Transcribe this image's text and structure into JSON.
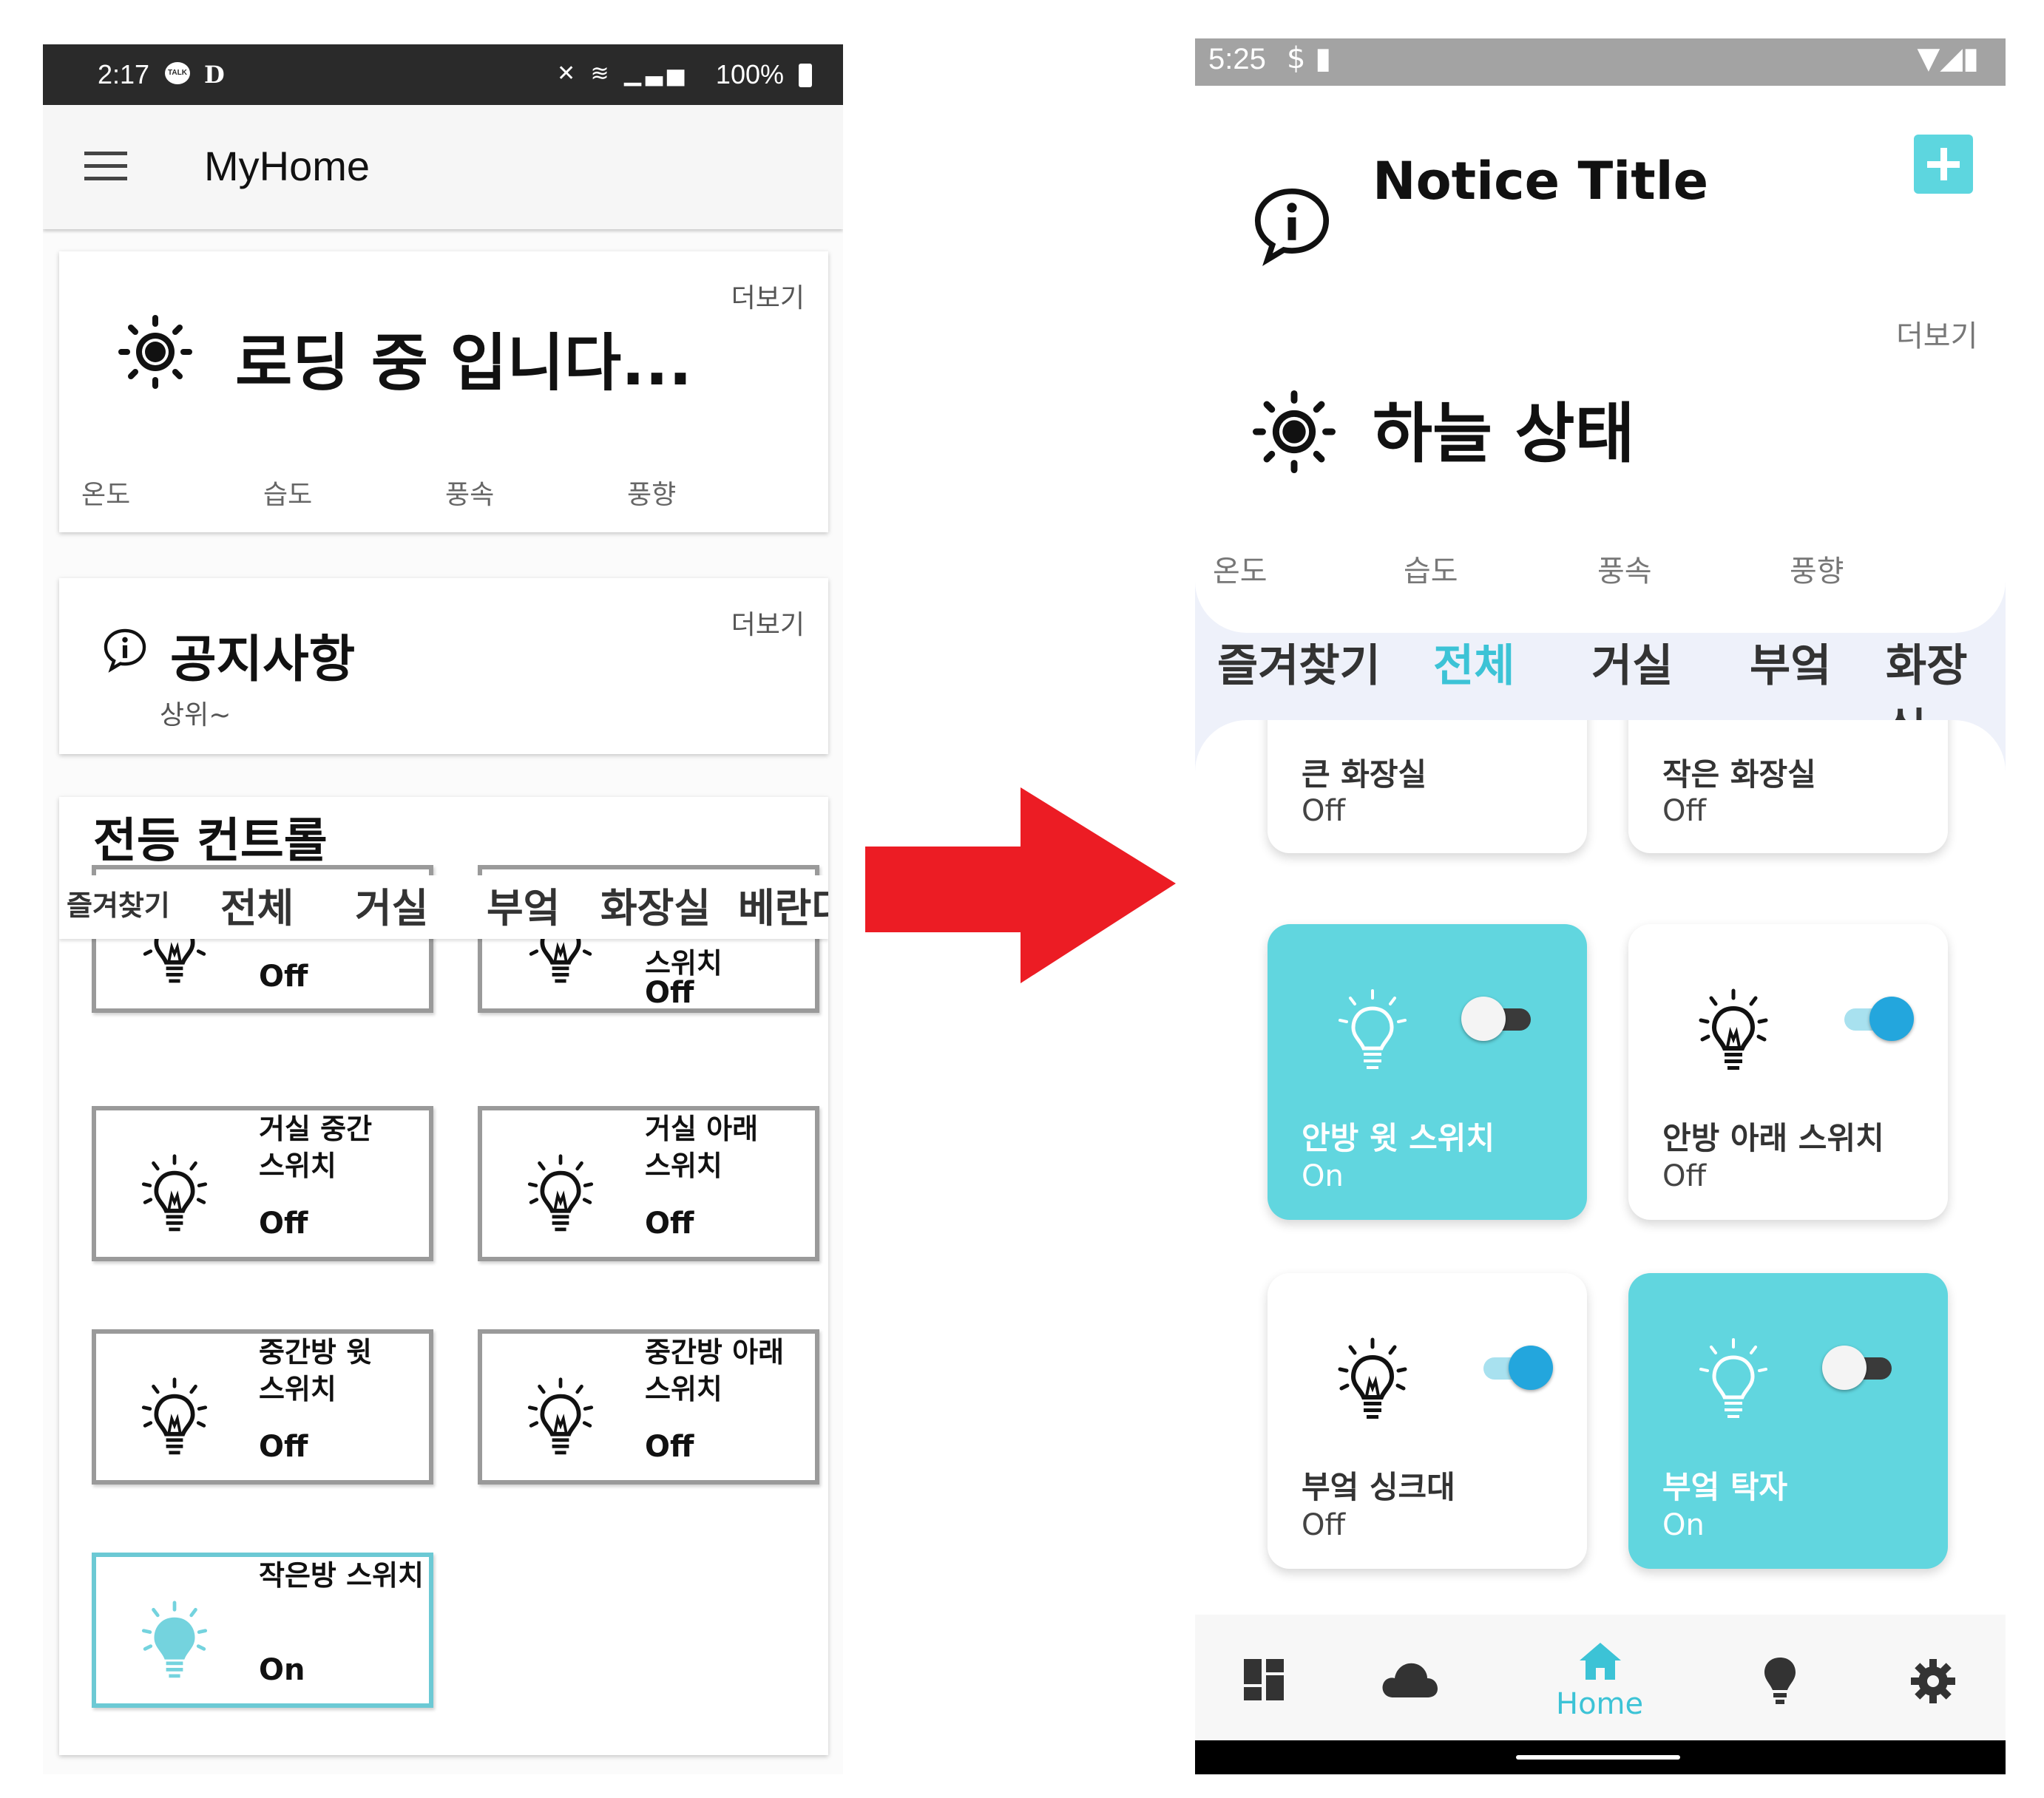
{
  "left": {
    "status": {
      "time": "2:17",
      "talk": "TALK",
      "d": "D",
      "battery": "100%"
    },
    "appbar": {
      "title": "MyHome"
    },
    "weather": {
      "title": "로딩 중 입니다...",
      "more": "더보기",
      "metrics": [
        "온도",
        "습도",
        "풍속",
        "풍향"
      ]
    },
    "notice": {
      "title": "공지사항",
      "more": "더보기",
      "body": "상위~"
    },
    "lights": {
      "title": "전등 컨트롤",
      "tabs": [
        "즐겨찾기",
        "전체",
        "거실",
        "부엌",
        "화장실",
        "베란다"
      ],
      "tiles": [
        {
          "name": "",
          "state": "Off",
          "on": false
        },
        {
          "name": "스위치",
          "state": "Off",
          "on": false
        },
        {
          "name": "거실 중간\n스위치",
          "state": "Off",
          "on": false
        },
        {
          "name": "거실 아래\n스위치",
          "state": "Off",
          "on": false
        },
        {
          "name": "중간방 윗\n스위치",
          "state": "Off",
          "on": false
        },
        {
          "name": "중간방 아래\n스위치",
          "state": "Off",
          "on": false
        },
        {
          "name": "작은방 스위치",
          "state": "On",
          "on": true
        }
      ]
    }
  },
  "right": {
    "status": {
      "time": "5:25"
    },
    "notice": {
      "title": "Notice Title"
    },
    "weather": {
      "title": "하늘 상태",
      "more": "더보기",
      "metrics": [
        "온도",
        "습도",
        "풍속",
        "풍향"
      ]
    },
    "tabs": [
      "즐겨찾기",
      "전체",
      "거실",
      "부엌",
      "화장실"
    ],
    "active_tab": "전체",
    "tiles": [
      {
        "name": "큰 화장실",
        "state": "Off",
        "on": false,
        "switch_on": false
      },
      {
        "name": "작은 화장실",
        "state": "Off",
        "on": false,
        "switch_on": false
      },
      {
        "name": "안방 윗 스위치",
        "state": "On",
        "on": true,
        "switch_on": false
      },
      {
        "name": "안방 아래 스위치",
        "state": "Off",
        "on": false,
        "switch_on": true
      },
      {
        "name": "부엌 싱크대",
        "state": "Off",
        "on": false,
        "switch_on": true
      },
      {
        "name": "부엌 탁자",
        "state": "On",
        "on": true,
        "switch_on": false
      }
    ],
    "bottom_nav": {
      "active_label": "Home",
      "items": [
        "dashboard-icon",
        "cloud-icon",
        "home-icon",
        "lightbulb-icon",
        "settings-icon"
      ]
    }
  },
  "colors": {
    "accent": "#5dd6df",
    "arrow": "#ec1c24",
    "tab_active": "#3cc3d6",
    "toggle_on": "#23a6dd"
  }
}
